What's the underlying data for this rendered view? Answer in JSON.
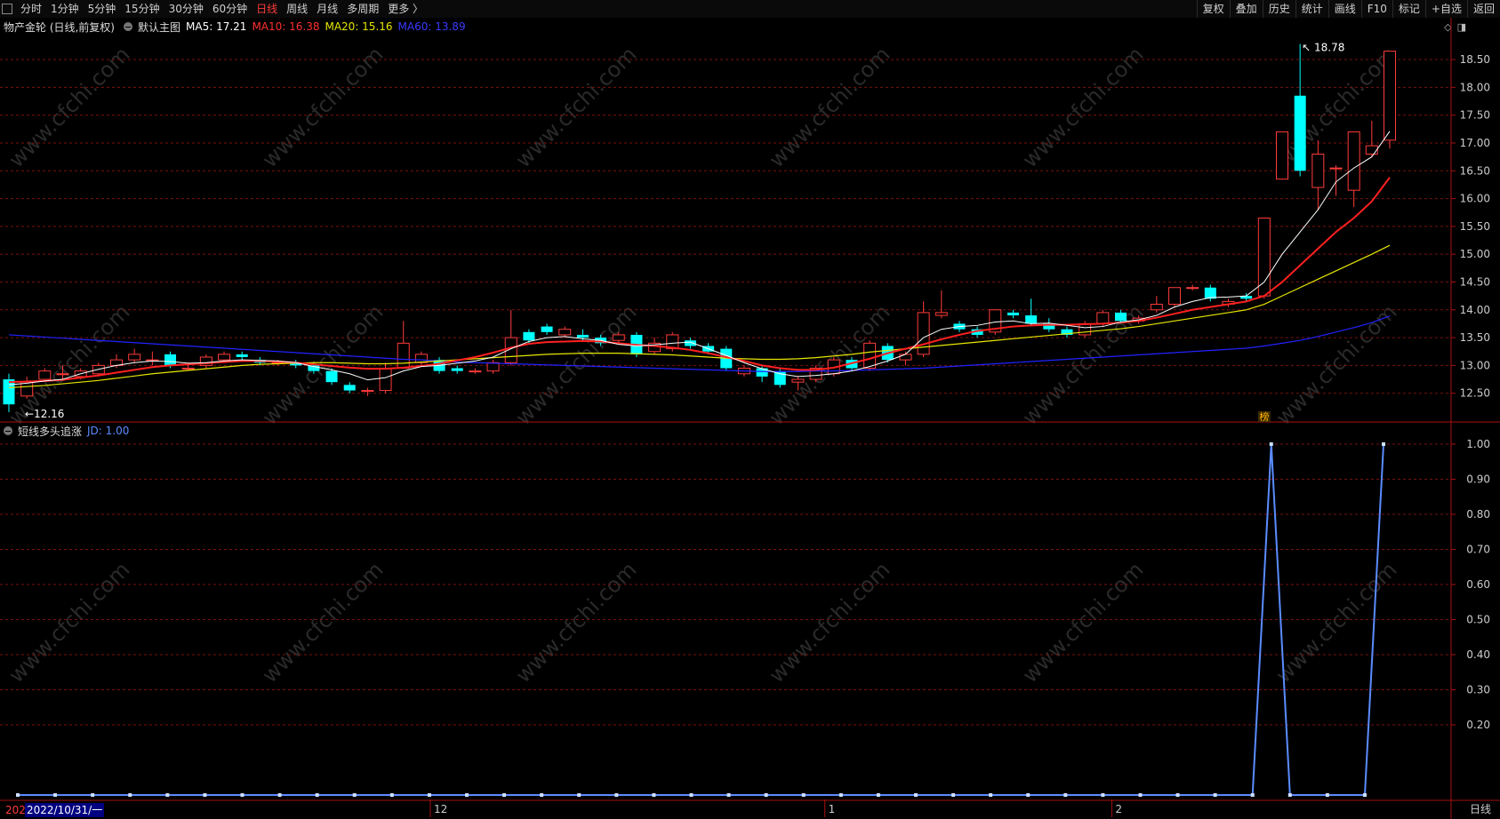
{
  "toolbar": {
    "periods": [
      "分时",
      "1分钟",
      "5分钟",
      "15分钟",
      "30分钟",
      "60分钟",
      "日线",
      "周线",
      "月线",
      "多周期",
      "更多 〉"
    ],
    "active_period": "日线",
    "actions": [
      "复权",
      "叠加",
      "历史",
      "统计",
      "画线",
      "F10",
      "标记",
      "+自选",
      "返回"
    ]
  },
  "main_legend": {
    "stock": "物产金轮 (日线,前复权)",
    "template": "默认主图",
    "ma5": "MA5: 17.21",
    "ma10": "MA10: 16.38",
    "ma20": "MA20: 15.16",
    "ma60": "MA60: 13.89"
  },
  "sub_legend": {
    "indicator": "短线多头追涨",
    "jd": "JD: 1.00"
  },
  "colors": {
    "up": "#ff3b3b",
    "down": "#00ffff",
    "ma5": "#ffffff",
    "ma10": "#ff2020",
    "ma20": "#e6e600",
    "ma60": "#2222ff",
    "jd": "#5b8cff",
    "grid": "#7a1010"
  },
  "chart_data": [
    {
      "type": "candlestick",
      "title": "物产金轮 (日线,前复权)",
      "ylim": [
        12.0,
        18.9
      ],
      "yticks": [
        "18.50",
        "18.00",
        "17.50",
        "17.00",
        "16.50",
        "16.00",
        "15.50",
        "15.00",
        "14.50",
        "14.00",
        "13.50",
        "13.00",
        "12.50"
      ],
      "x_month_labels": [
        "12",
        "1",
        "2"
      ],
      "annotations": {
        "high": "18.78",
        "low": "12.16",
        "marker": "榜"
      },
      "candles": [
        [
          12.75,
          12.3,
          12.85,
          12.16
        ],
        [
          12.45,
          12.7,
          12.8,
          12.4
        ],
        [
          12.75,
          12.9,
          12.95,
          12.7
        ],
        [
          12.85,
          12.85,
          13.0,
          12.75
        ],
        [
          12.8,
          12.9,
          12.95,
          12.75
        ],
        [
          12.85,
          13.0,
          13.05,
          12.8
        ],
        [
          13.0,
          13.1,
          13.2,
          12.95
        ],
        [
          13.1,
          13.2,
          13.3,
          13.05
        ],
        [
          13.1,
          13.1,
          13.25,
          13.0
        ],
        [
          13.2,
          13.0,
          13.25,
          12.95
        ],
        [
          12.95,
          12.95,
          13.05,
          12.9
        ],
        [
          13.0,
          13.15,
          13.2,
          12.95
        ],
        [
          13.1,
          13.2,
          13.25,
          13.05
        ],
        [
          13.2,
          13.15,
          13.25,
          13.1
        ],
        [
          13.1,
          13.05,
          13.15,
          13.0
        ],
        [
          13.05,
          13.05,
          13.1,
          13.0
        ],
        [
          13.05,
          13.0,
          13.1,
          12.95
        ],
        [
          13.0,
          12.9,
          13.05,
          12.85
        ],
        [
          12.9,
          12.7,
          12.95,
          12.65
        ],
        [
          12.65,
          12.55,
          12.7,
          12.5
        ],
        [
          12.55,
          12.55,
          12.6,
          12.45
        ],
        [
          12.55,
          12.95,
          13.05,
          12.5
        ],
        [
          12.95,
          13.4,
          13.8,
          12.95
        ],
        [
          13.05,
          13.2,
          13.25,
          13.0
        ],
        [
          13.1,
          12.9,
          13.15,
          12.85
        ],
        [
          12.95,
          12.9,
          13.0,
          12.85
        ],
        [
          12.9,
          12.9,
          12.95,
          12.85
        ],
        [
          12.9,
          13.05,
          13.1,
          12.85
        ],
        [
          13.05,
          13.5,
          14.0,
          13.0
        ],
        [
          13.6,
          13.45,
          13.65,
          13.4
        ],
        [
          13.7,
          13.6,
          13.75,
          13.55
        ],
        [
          13.55,
          13.65,
          13.7,
          13.5
        ],
        [
          13.55,
          13.5,
          13.65,
          13.45
        ],
        [
          13.5,
          13.4,
          13.55,
          13.35
        ],
        [
          13.45,
          13.55,
          13.6,
          13.4
        ],
        [
          13.55,
          13.2,
          13.6,
          13.15
        ],
        [
          13.25,
          13.4,
          13.5,
          13.2
        ],
        [
          13.3,
          13.55,
          13.6,
          13.25
        ],
        [
          13.45,
          13.35,
          13.5,
          13.3
        ],
        [
          13.35,
          13.25,
          13.4,
          13.2
        ],
        [
          13.3,
          12.95,
          13.35,
          12.9
        ],
        [
          12.85,
          12.95,
          13.0,
          12.8
        ],
        [
          12.95,
          12.8,
          13.0,
          12.7
        ],
        [
          12.9,
          12.65,
          12.95,
          12.6
        ],
        [
          12.7,
          12.75,
          12.8,
          12.55
        ],
        [
          12.75,
          12.95,
          13.0,
          12.7
        ],
        [
          12.85,
          13.1,
          13.15,
          12.8
        ],
        [
          13.1,
          12.95,
          13.15,
          12.9
        ],
        [
          12.95,
          13.4,
          13.45,
          12.9
        ],
        [
          13.35,
          13.1,
          13.4,
          13.05
        ],
        [
          13.1,
          13.2,
          13.25,
          13.0
        ],
        [
          13.2,
          13.95,
          14.15,
          13.15
        ],
        [
          13.9,
          13.95,
          14.35,
          13.85
        ],
        [
          13.75,
          13.65,
          13.8,
          13.6
        ],
        [
          13.65,
          13.55,
          13.7,
          13.5
        ],
        [
          13.6,
          14.0,
          14.0,
          13.55
        ],
        [
          13.95,
          13.9,
          14.0,
          13.85
        ],
        [
          13.9,
          13.75,
          14.2,
          13.7
        ],
        [
          13.75,
          13.65,
          13.85,
          13.6
        ],
        [
          13.65,
          13.55,
          13.7,
          13.5
        ],
        [
          13.55,
          13.75,
          13.8,
          13.5
        ],
        [
          13.75,
          13.95,
          14.0,
          13.7
        ],
        [
          13.95,
          13.8,
          14.0,
          13.75
        ],
        [
          13.8,
          13.85,
          13.9,
          13.75
        ],
        [
          14.0,
          14.1,
          14.25,
          13.95
        ],
        [
          14.1,
          14.4,
          14.4,
          14.05
        ],
        [
          14.4,
          14.4,
          14.45,
          14.35
        ],
        [
          14.4,
          14.2,
          14.45,
          14.15
        ],
        [
          14.1,
          14.15,
          14.2,
          14.05
        ],
        [
          14.25,
          14.2,
          14.3,
          14.15
        ],
        [
          14.25,
          15.65,
          15.65,
          14.2
        ],
        [
          16.35,
          17.2,
          17.2,
          16.4
        ],
        [
          17.85,
          16.5,
          18.78,
          16.4
        ],
        [
          16.2,
          16.8,
          17.05,
          15.8
        ],
        [
          16.55,
          16.55,
          16.6,
          16.05
        ],
        [
          16.15,
          17.2,
          17.2,
          15.85
        ],
        [
          16.8,
          16.95,
          17.4,
          16.75
        ],
        [
          17.05,
          18.65,
          18.65,
          16.9
        ]
      ],
      "ma5": [
        12.65,
        12.68,
        12.72,
        12.75,
        12.85,
        12.93,
        13.0,
        13.05,
        13.08,
        13.07,
        13.04,
        13.05,
        13.08,
        13.1,
        13.09,
        13.08,
        13.05,
        12.98,
        12.92,
        12.85,
        12.74,
        12.78,
        12.9,
        12.98,
        13.0,
        13.04,
        13.08,
        13.15,
        13.3,
        13.43,
        13.5,
        13.52,
        13.48,
        13.45,
        13.38,
        13.35,
        13.37,
        13.4,
        13.42,
        13.3,
        13.18,
        13.05,
        12.94,
        12.85,
        12.8,
        12.82,
        12.85,
        12.9,
        12.98,
        13.08,
        13.2,
        13.5,
        13.65,
        13.7,
        13.72,
        13.78,
        13.8,
        13.75,
        13.76,
        13.72,
        13.68,
        13.7,
        13.78,
        13.82,
        13.9,
        14.05,
        14.15,
        14.22,
        14.23,
        14.25,
        14.5,
        15.0,
        15.4,
        15.8,
        16.3,
        16.55,
        16.75,
        17.21
      ],
      "ma10": [
        12.7,
        12.71,
        12.72,
        12.74,
        12.78,
        12.82,
        12.87,
        12.92,
        12.97,
        13.0,
        13.02,
        13.04,
        13.06,
        13.08,
        13.08,
        13.07,
        13.05,
        13.02,
        12.99,
        12.96,
        12.94,
        12.94,
        12.96,
        12.99,
        13.03,
        13.09,
        13.15,
        13.23,
        13.32,
        13.39,
        13.42,
        13.43,
        13.44,
        13.43,
        13.4,
        13.37,
        13.35,
        13.32,
        13.28,
        13.22,
        13.15,
        13.08,
        13.0,
        12.95,
        12.92,
        12.92,
        12.96,
        13.04,
        13.12,
        13.22,
        13.3,
        13.38,
        13.47,
        13.55,
        13.62,
        13.66,
        13.7,
        13.72,
        13.73,
        13.73,
        13.74,
        13.75,
        13.77,
        13.8,
        13.86,
        13.93,
        14.0,
        14.05,
        14.1,
        14.15,
        14.25,
        14.5,
        14.8,
        15.1,
        15.4,
        15.65,
        15.95,
        16.38
      ],
      "ma20": [
        12.6,
        12.62,
        12.64,
        12.67,
        12.7,
        12.73,
        12.77,
        12.81,
        12.85,
        12.88,
        12.91,
        12.94,
        12.97,
        13.0,
        13.02,
        13.03,
        13.04,
        13.05,
        13.05,
        13.04,
        13.03,
        13.03,
        13.04,
        13.06,
        13.08,
        13.1,
        13.12,
        13.14,
        13.16,
        13.18,
        13.2,
        13.21,
        13.22,
        13.22,
        13.22,
        13.21,
        13.2,
        13.19,
        13.17,
        13.15,
        13.13,
        13.12,
        13.11,
        13.11,
        13.12,
        13.14,
        13.17,
        13.2,
        13.24,
        13.27,
        13.3,
        13.33,
        13.36,
        13.39,
        13.42,
        13.45,
        13.48,
        13.51,
        13.54,
        13.57,
        13.6,
        13.63,
        13.66,
        13.7,
        13.75,
        13.8,
        13.85,
        13.9,
        13.95,
        14.0,
        14.1,
        14.25,
        14.4,
        14.55,
        14.7,
        14.85,
        15.0,
        15.16
      ],
      "ma60": [
        13.55,
        13.53,
        13.51,
        13.49,
        13.47,
        13.45,
        13.43,
        13.41,
        13.39,
        13.37,
        13.35,
        13.33,
        13.31,
        13.29,
        13.27,
        13.25,
        13.23,
        13.21,
        13.19,
        13.17,
        13.15,
        13.13,
        13.11,
        13.1,
        13.08,
        13.06,
        13.05,
        13.04,
        13.03,
        13.02,
        13.01,
        13.0,
        12.99,
        12.98,
        12.97,
        12.96,
        12.95,
        12.94,
        12.93,
        12.92,
        12.91,
        12.9,
        12.89,
        12.89,
        12.89,
        12.9,
        12.9,
        12.91,
        12.92,
        12.93,
        12.94,
        12.95,
        12.97,
        12.99,
        13.01,
        13.03,
        13.05,
        13.07,
        13.09,
        13.11,
        13.13,
        13.15,
        13.17,
        13.19,
        13.21,
        13.23,
        13.25,
        13.27,
        13.29,
        13.31,
        13.35,
        13.4,
        13.45,
        13.52,
        13.6,
        13.68,
        13.77,
        13.89
      ]
    },
    {
      "type": "line",
      "series": [
        {
          "name": "JD",
          "values": [
            0,
            0,
            0,
            0,
            0,
            0,
            0,
            0,
            0,
            0,
            0,
            0,
            0,
            0,
            0,
            0,
            0,
            0,
            0,
            0,
            0,
            0,
            0,
            0,
            0,
            0,
            0,
            0,
            0,
            0,
            0,
            0,
            0,
            0,
            0,
            0,
            0,
            0,
            0,
            0,
            0,
            0,
            0,
            0,
            0,
            0,
            0,
            0,
            0,
            0,
            0,
            0,
            0,
            0,
            0,
            0,
            0,
            0,
            0,
            0,
            0,
            0,
            0,
            0,
            0,
            0,
            0,
            1,
            0,
            0,
            0,
            0,
            0,
            1
          ]
        }
      ],
      "ylim": [
        0,
        1.0
      ],
      "yticks": [
        "1.00",
        "0.90",
        "0.80",
        "0.70",
        "0.60",
        "0.50",
        "0.40",
        "0.30",
        "0.20"
      ]
    }
  ],
  "date_prefix": "202",
  "date_selected": "2022/10/31/一",
  "status_period": "日线",
  "watermark": "www.cfchi.com"
}
